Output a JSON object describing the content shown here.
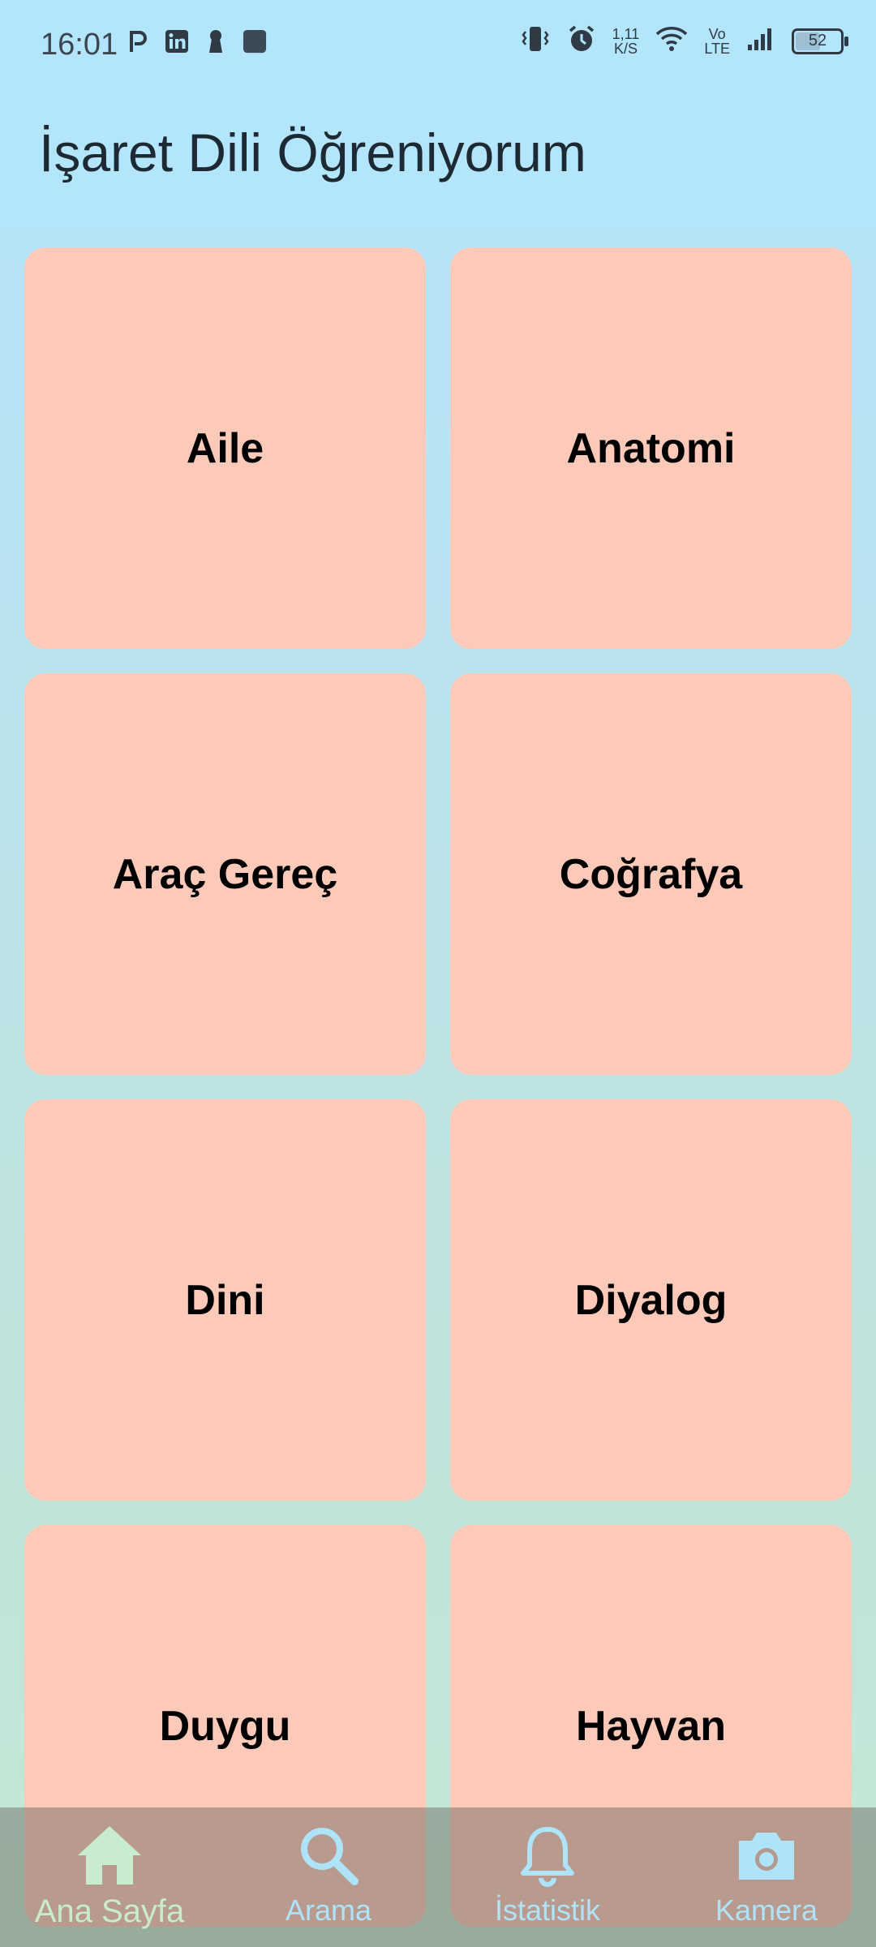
{
  "status_bar": {
    "time": "16:01",
    "net_speed_value": "1,11",
    "net_speed_unit": "K/S",
    "volte_top": "Vo",
    "volte_bottom": "LTE",
    "battery": "52",
    "left_icons": [
      "p-icon",
      "linkedin-icon",
      "keyhole-icon",
      "square-icon"
    ],
    "right_icons": [
      "vibrate-icon",
      "alarm-icon",
      "wifi-icon",
      "signal-icon"
    ]
  },
  "app_bar": {
    "title": "İşaret Dili Öğreniyorum"
  },
  "categories": [
    {
      "label": "Aile"
    },
    {
      "label": "Anatomi"
    },
    {
      "label": "Araç Gereç"
    },
    {
      "label": "Coğrafya"
    },
    {
      "label": "Dini"
    },
    {
      "label": "Diyalog"
    },
    {
      "label": "Duygu"
    },
    {
      "label": "Hayvan"
    }
  ],
  "bottom_nav": {
    "items": [
      {
        "label": "Ana Sayfa",
        "icon": "home-icon",
        "active": true
      },
      {
        "label": "Arama",
        "icon": "search-icon",
        "active": false
      },
      {
        "label": "İstatistik",
        "icon": "bell-icon",
        "active": false
      },
      {
        "label": "Kamera",
        "icon": "camera-icon",
        "active": false
      }
    ]
  },
  "colors": {
    "card": "#fdc9b8",
    "app_bar": "#b3e5fc",
    "nav_active": "#c8eccd",
    "nav_inactive": "#aee3f8"
  }
}
